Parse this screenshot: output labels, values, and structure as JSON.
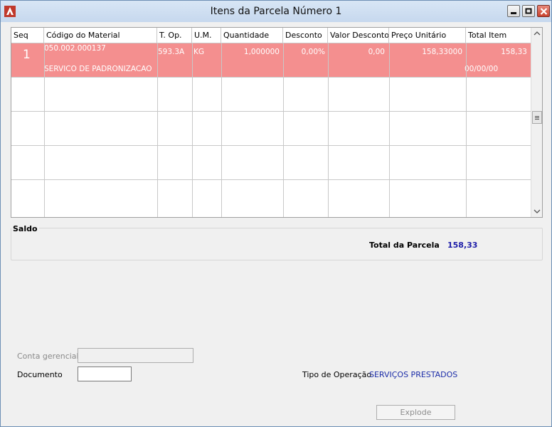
{
  "window": {
    "title": "Itens da Parcela Número 1"
  },
  "grid": {
    "columns": [
      {
        "label": "Seq"
      },
      {
        "label": "Código do Material"
      },
      {
        "label": "T. Op."
      },
      {
        "label": "U.M."
      },
      {
        "label": "Quantidade"
      },
      {
        "label": "Desconto"
      },
      {
        "label": "Valor Desconto"
      },
      {
        "label": "Preço Unitário"
      },
      {
        "label": "Total Item"
      }
    ],
    "rows": [
      {
        "seq": "1",
        "codigo": "050.002.000137",
        "descricao": "SERVICO DE PADRONIZACAO",
        "t_op": "593.3A",
        "um": "KG",
        "quantidade": "1,000000",
        "desconto": "0,00%",
        "valor_desconto": "0,00",
        "preco_unitario": "158,33000",
        "total_item": "158,33",
        "data": "00/00/00",
        "row_color": "#f48f8f"
      }
    ]
  },
  "saldo": {
    "group_label": "Saldo",
    "total_label": "Total da Parcela",
    "total_value": "158,33"
  },
  "form": {
    "conta_gerencial_label": "Conta gerencial",
    "conta_gerencial_value": "",
    "documento_label": "Documento",
    "documento_value": "",
    "tipo_operacao_label": "Tipo de Operação",
    "tipo_operacao_value": "SERVIÇOS PRESTADOS"
  },
  "buttons": {
    "explode_label": "Explode"
  },
  "icons": {
    "app": "app-logo-icon",
    "minimize": "minimize-icon",
    "maximize": "maximize-icon",
    "close": "close-icon",
    "scroll_up": "chevron-up-icon",
    "scroll_down": "chevron-down-icon"
  },
  "colors": {
    "accent_value": "#1c1ca8",
    "selected_row": "#f48f8f"
  }
}
